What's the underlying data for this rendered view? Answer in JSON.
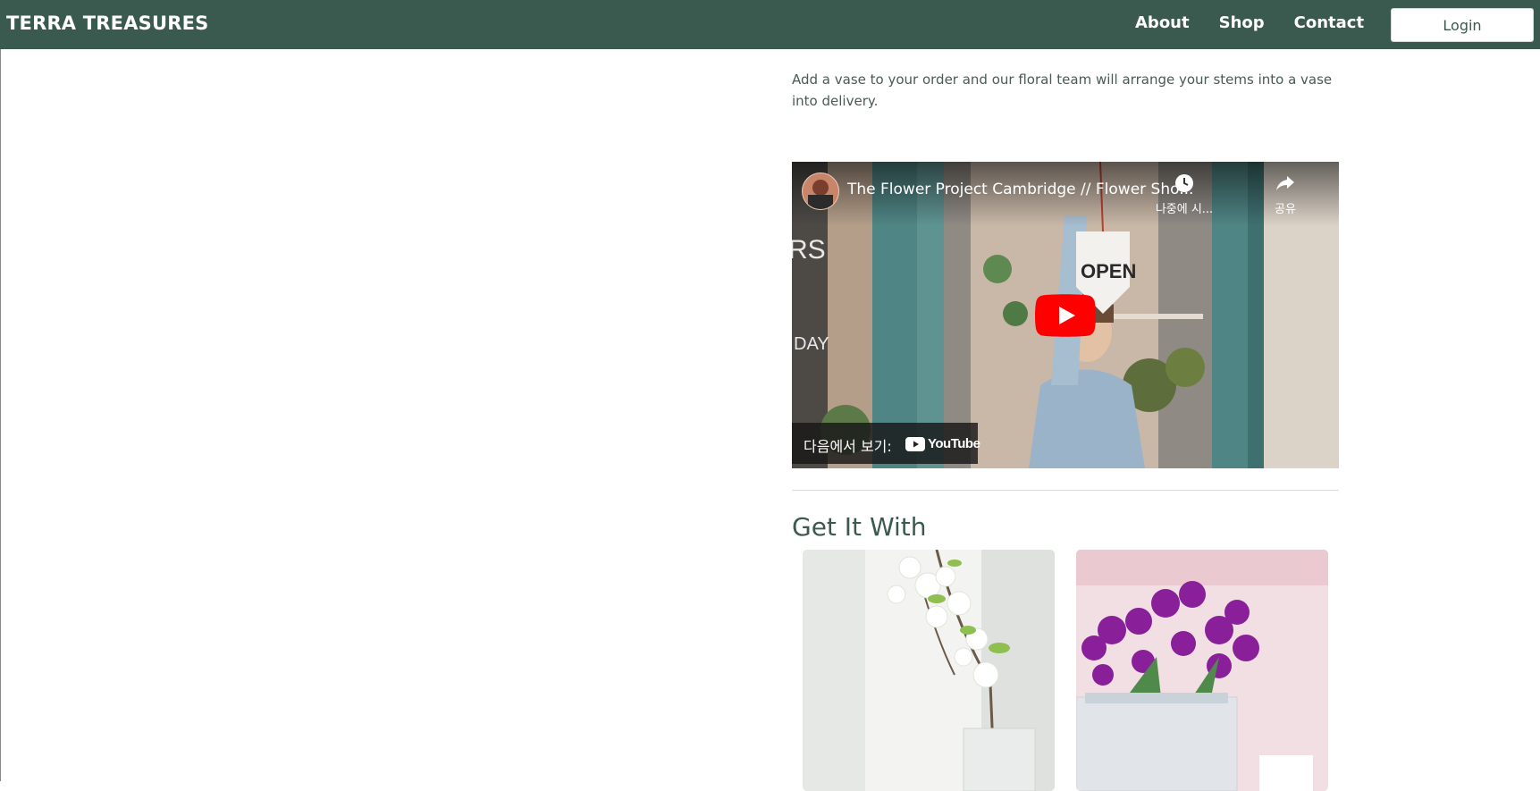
{
  "navbar": {
    "brand": "TERRA TREASURES",
    "links": [
      {
        "label": "About"
      },
      {
        "label": "Shop"
      },
      {
        "label": "Contact"
      }
    ],
    "login_label": "Login",
    "background": "#3b5a4f"
  },
  "content": {
    "paragraph": " Add a vase to your order and our floral team will arrange your stems into a vase into delivery.",
    "video": {
      "title": "The Flower Project Cambridge // Flower Sho...",
      "watch_later_label": "나중에 시...",
      "share_label": "공유",
      "watch_on_label": "다음에서 보기:",
      "youtube_wordmark": "YouTube",
      "sign_text": "OPEN"
    },
    "section_title": "Get It With",
    "products": [
      {
        "image": "white-blossom-vase-image"
      },
      {
        "image": "purple-hyacinth-jar-image"
      }
    ]
  },
  "colors": {
    "accent": "#3b5a4f",
    "youtube_red": "#ff0000"
  }
}
